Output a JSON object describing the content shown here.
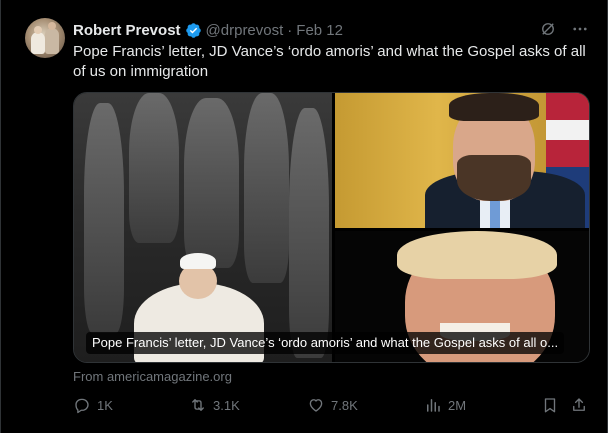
{
  "tweet": {
    "display_name": "Robert Prevost",
    "handle": "@drprevost",
    "separator": "·",
    "date": "Feb 12",
    "text": "Pope Francis’ letter, JD Vance’s ‘ordo amoris’ and what the Gospel asks of all of us on immigration",
    "verified_icon": "verified-badge-icon",
    "accent_color": "#1d9bf0"
  },
  "card": {
    "caption": "Pope Francis’ letter, JD Vance’s ‘ordo amoris’ and what the Gospel asks of all o...",
    "source": "From americamagazine.org"
  },
  "actions": {
    "replies": "1K",
    "reposts": "3.1K",
    "likes": "7.8K",
    "views": "2M"
  }
}
